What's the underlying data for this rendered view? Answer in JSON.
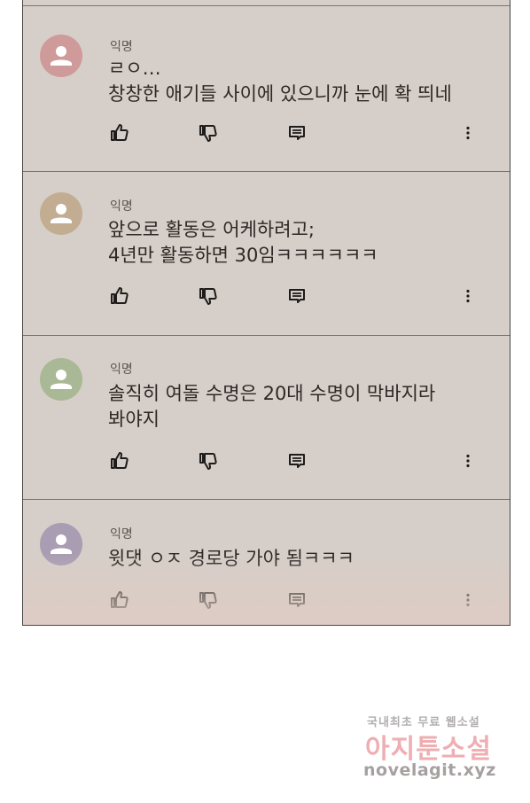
{
  "comments": [
    {
      "author": "익명",
      "text": "ㄹㅇ…\n창창한 애기들 사이에 있으니까 눈에 확 띄네",
      "avatar_color": "#cf9a9a"
    },
    {
      "author": "익명",
      "text": "앞으로 활동은 어케하려고;\n4년만 활동하면 30임ㅋㅋㅋㅋㅋㅋ",
      "avatar_color": "#c2ad93"
    },
    {
      "author": "익명",
      "text": "솔직히 여돌 수명은 20대 수명이 막바지라\n봐야지",
      "avatar_color": "#a9b895"
    },
    {
      "author": "익명",
      "text": "윗댓 ㅇㅈ 경로당 가야 됨ㅋㅋㅋ",
      "avatar_color": "#a89db2"
    }
  ],
  "icons": {
    "like": "thumbs-up-icon",
    "dislike": "thumbs-down-icon",
    "reply": "comment-icon",
    "more": "more-vertical-icon"
  },
  "watermark": {
    "line1": "국내최초 무료 웹소설",
    "line2": "아지툰소설",
    "line3": "novelagit.xyz"
  }
}
